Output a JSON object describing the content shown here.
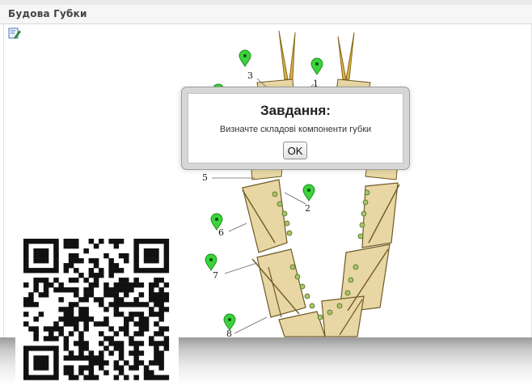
{
  "window": {
    "title": "Будова Губки"
  },
  "toolbar": {
    "edit_icon": "edit-icon"
  },
  "diagram": {
    "labels": [
      "3",
      "1",
      "5",
      "2",
      "6",
      "7",
      "8"
    ],
    "marker_color": "#3bd33b",
    "marker_icon": "map-pin-icon"
  },
  "dialog": {
    "title": "Завдання:",
    "message": "Визначте складові компоненти губки",
    "ok_label": "OK"
  },
  "qr": {
    "icon": "qr-code-icon"
  }
}
